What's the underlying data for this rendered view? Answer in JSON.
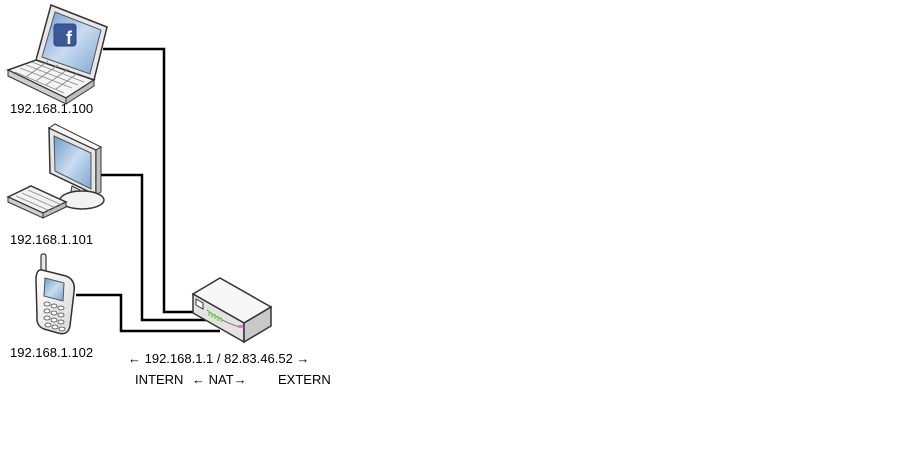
{
  "devices": {
    "laptop": {
      "ip": "192.168.1.100",
      "screen_badge": "f"
    },
    "desktop": {
      "ip": "192.168.1.101"
    },
    "phone": {
      "ip": "192.168.1.102"
    }
  },
  "router": {
    "address_line": "← 192.168.1.1 / 82.83.46.52 →",
    "intern_label": "INTERN",
    "nat_label": "←  NAT→",
    "extern_label": "EXTERN"
  },
  "colors": {
    "cable": "#000000",
    "device_outline": "#333333",
    "device_fill": "#f2f2f2",
    "screen": "#8fb3d9",
    "facebook": "#3b5998",
    "led_green": "#7ed957",
    "led_pink": "#e37ad6"
  }
}
